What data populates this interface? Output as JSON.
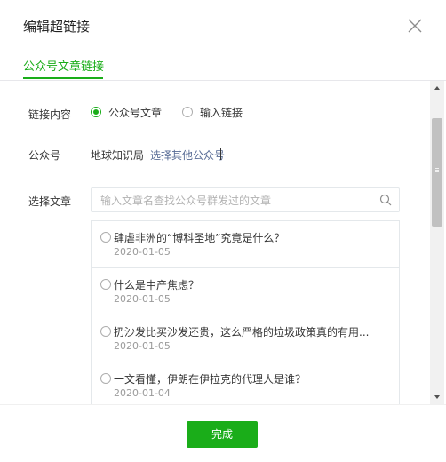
{
  "dialog": {
    "title": "编辑超链接"
  },
  "tabs": [
    {
      "label": "公众号文章链接",
      "active": true
    }
  ],
  "form": {
    "content_label": "链接内容",
    "options": [
      {
        "label": "公众号文章",
        "checked": true
      },
      {
        "label": "输入链接",
        "checked": false
      }
    ],
    "account_label": "公众号",
    "account_name": "地球知识局",
    "account_link": "选择其他公众号",
    "article_label": "选择文章",
    "search_placeholder": "输入文章名查找公众号群发过的文章"
  },
  "articles": [
    {
      "title": "肆虐非洲的“博科圣地”究竟是什么？",
      "date": "2020-01-05"
    },
    {
      "title": "什么是中产焦虑？",
      "date": "2020-01-05"
    },
    {
      "title": "扔沙发比买沙发还贵，这么严格的垃圾政策真的有用...",
      "date": "2020-01-05"
    },
    {
      "title": "一文看懂，伊朗在伊拉克的代理人是谁？",
      "date": "2020-01-04"
    }
  ],
  "footer": {
    "done_label": "完成"
  },
  "colors": {
    "accent": "#1aad19",
    "link": "#576b95"
  }
}
